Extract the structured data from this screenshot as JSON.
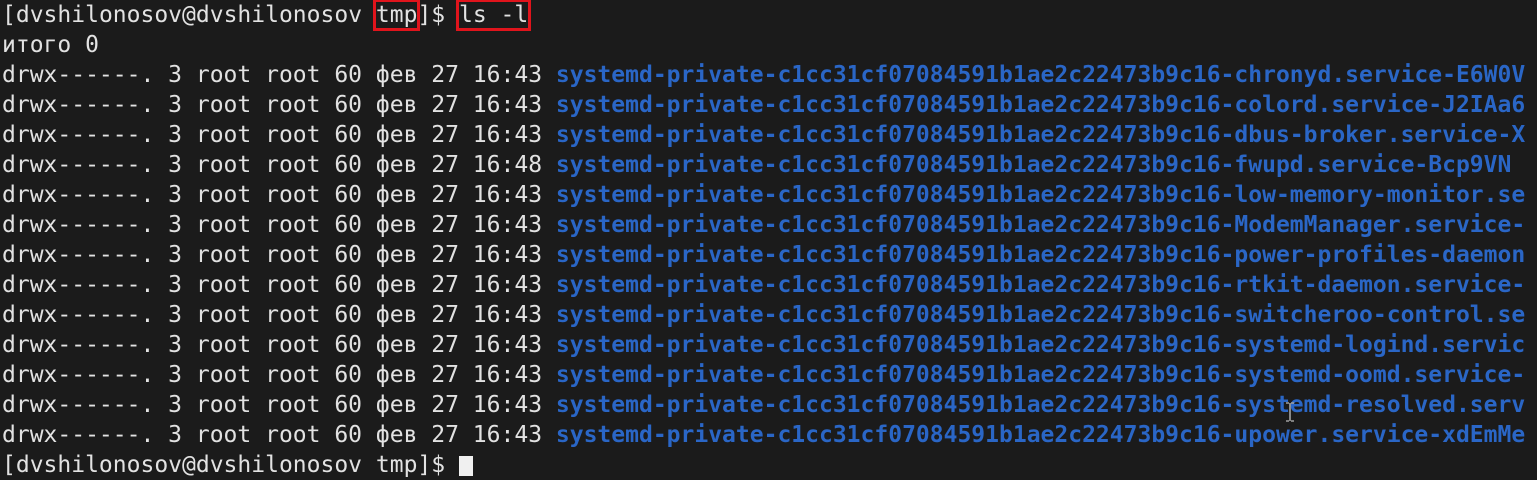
{
  "prompt": {
    "open_bracket": "[",
    "user_host": "dvshilonosov@dvshilonosov ",
    "cwd": "tmp",
    "close_suffix": "]$ ",
    "command": "ls -l"
  },
  "total_line": "итого 0",
  "listing": [
    {
      "meta": "drwx------. 3 root root 60 фев 27 16:43 ",
      "name": "systemd-private-c1cc31cf07084591b1ae2c22473b9c16-chronyd.service-E6W0V"
    },
    {
      "meta": "drwx------. 3 root root 60 фев 27 16:43 ",
      "name": "systemd-private-c1cc31cf07084591b1ae2c22473b9c16-colord.service-J2IAa6"
    },
    {
      "meta": "drwx------. 3 root root 60 фев 27 16:43 ",
      "name": "systemd-private-c1cc31cf07084591b1ae2c22473b9c16-dbus-broker.service-X"
    },
    {
      "meta": "drwx------. 3 root root 60 фев 27 16:48 ",
      "name": "systemd-private-c1cc31cf07084591b1ae2c22473b9c16-fwupd.service-Bcp9VN"
    },
    {
      "meta": "drwx------. 3 root root 60 фев 27 16:43 ",
      "name": "systemd-private-c1cc31cf07084591b1ae2c22473b9c16-low-memory-monitor.se"
    },
    {
      "meta": "drwx------. 3 root root 60 фев 27 16:43 ",
      "name": "systemd-private-c1cc31cf07084591b1ae2c22473b9c16-ModemManager.service-"
    },
    {
      "meta": "drwx------. 3 root root 60 фев 27 16:43 ",
      "name": "systemd-private-c1cc31cf07084591b1ae2c22473b9c16-power-profiles-daemon"
    },
    {
      "meta": "drwx------. 3 root root 60 фев 27 16:43 ",
      "name": "systemd-private-c1cc31cf07084591b1ae2c22473b9c16-rtkit-daemon.service-"
    },
    {
      "meta": "drwx------. 3 root root 60 фев 27 16:43 ",
      "name": "systemd-private-c1cc31cf07084591b1ae2c22473b9c16-switcheroo-control.se"
    },
    {
      "meta": "drwx------. 3 root root 60 фев 27 16:43 ",
      "name": "systemd-private-c1cc31cf07084591b1ae2c22473b9c16-systemd-logind.servic"
    },
    {
      "meta": "drwx------. 3 root root 60 фев 27 16:43 ",
      "name": "systemd-private-c1cc31cf07084591b1ae2c22473b9c16-systemd-oomd.service-"
    },
    {
      "meta": "drwx------. 3 root root 60 фев 27 16:43 ",
      "name": "systemd-private-c1cc31cf07084591b1ae2c22473b9c16-systemd-resolved.serv"
    },
    {
      "meta": "drwx------. 3 root root 60 фев 27 16:43 ",
      "name": "systemd-private-c1cc31cf07084591b1ae2c22473b9c16-upower.service-xdEmMe"
    }
  ],
  "next_prompt": "[dvshilonosov@dvshilonosov tmp]$ ",
  "colors": {
    "background": "#1b1b1b",
    "text": "#e2e2e2",
    "directory": "#2a66c6",
    "highlight": "#e0141c"
  }
}
